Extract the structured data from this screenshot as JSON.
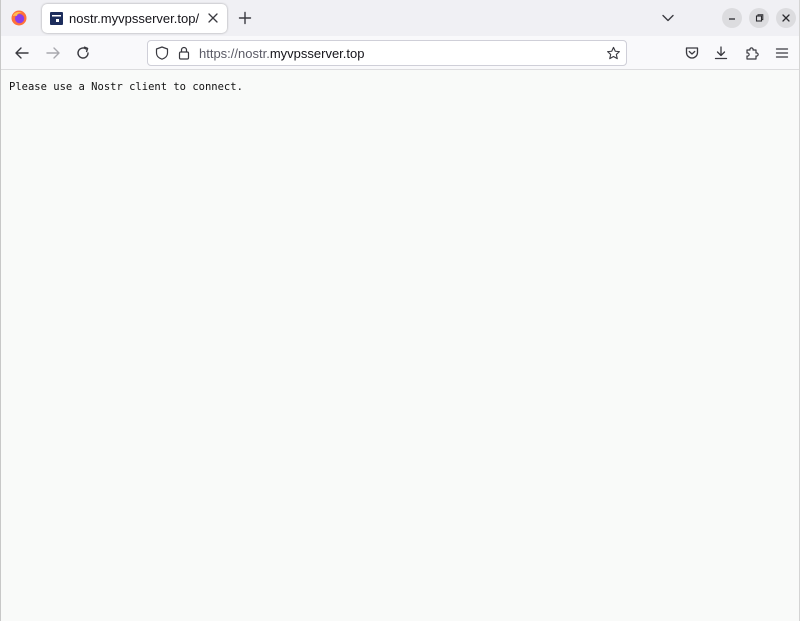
{
  "tab": {
    "title": "nostr.myvpsserver.top/"
  },
  "urlbar": {
    "scheme": "https://",
    "subdomain": "nostr.",
    "host": "myvpsserver.top"
  },
  "page": {
    "text": "Please use a Nostr client to connect."
  },
  "colors": {
    "tabstrip": "#f0f0f4",
    "toolbar": "#f9f9fb",
    "page_background": "#f9faf9",
    "favicon": "#1d2d5c"
  },
  "icons": {
    "browser": "firefox-logo-icon",
    "favicon": "site-favicon-icon",
    "tab_close": "close-icon",
    "new_tab": "plus-icon",
    "list_tabs": "chevron-down-icon",
    "minimize": "minimize-icon",
    "maximize": "restore-icon",
    "close_window": "close-icon",
    "back": "arrow-left-icon",
    "forward": "arrow-right-icon",
    "reload": "reload-icon",
    "tracking_protection": "shield-icon",
    "security": "lock-icon",
    "bookmark": "star-icon",
    "pocket": "pocket-icon",
    "downloads": "download-icon",
    "extensions": "puzzle-icon",
    "menu": "hamburger-menu-icon"
  }
}
